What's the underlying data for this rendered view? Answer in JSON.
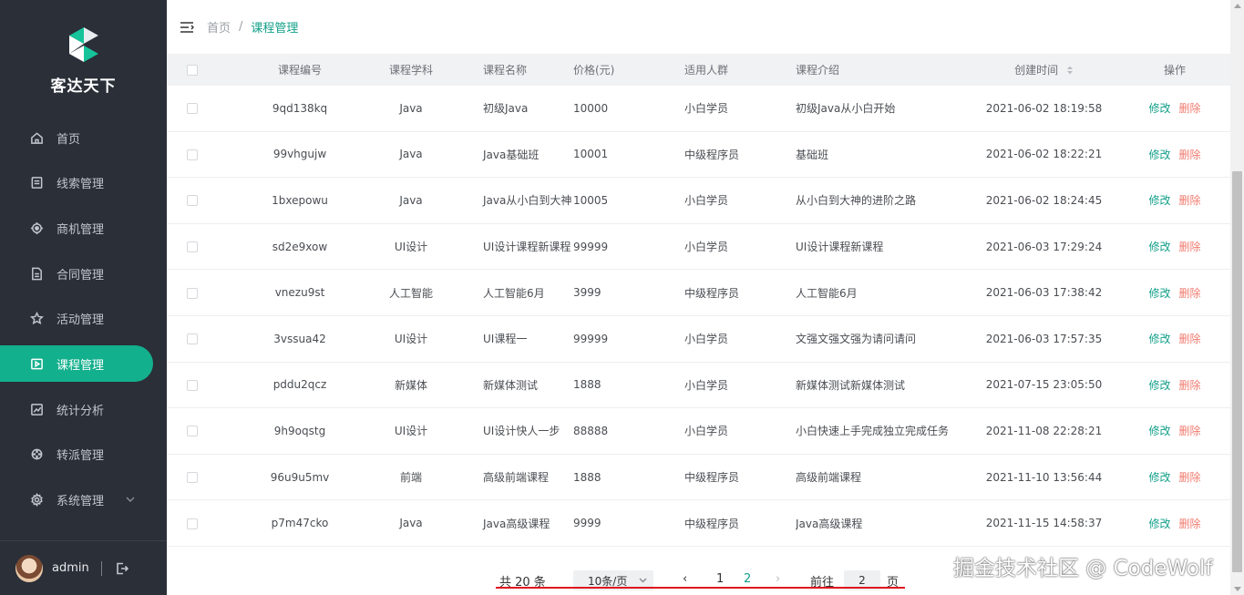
{
  "app": {
    "brand": "客达天下"
  },
  "sidebar": {
    "items": [
      {
        "label": "首页",
        "icon": "home-icon"
      },
      {
        "label": "线索管理",
        "icon": "clipboard-icon"
      },
      {
        "label": "商机管理",
        "icon": "target-icon"
      },
      {
        "label": "合同管理",
        "icon": "document-icon"
      },
      {
        "label": "活动管理",
        "icon": "star-icon"
      },
      {
        "label": "课程管理",
        "icon": "play-icon",
        "active": true
      },
      {
        "label": "统计分析",
        "icon": "chart-icon"
      },
      {
        "label": "转派管理",
        "icon": "transfer-icon"
      },
      {
        "label": "系统管理",
        "icon": "gear-icon",
        "expandable": true
      }
    ],
    "user": {
      "name": "admin"
    }
  },
  "header": {
    "breadcrumb": {
      "home": "首页",
      "separator": "/",
      "current": "课程管理"
    }
  },
  "table": {
    "columns": [
      "课程编号",
      "课程学科",
      "课程名称",
      "价格(元)",
      "适用人群",
      "课程介绍",
      "创建时间",
      "操作"
    ],
    "actions": {
      "edit": "修改",
      "delete": "删除"
    },
    "rows": [
      {
        "id": "9qd138kq",
        "subject": "Java",
        "name": "初级Java",
        "price": "10000",
        "crowd": "小白学员",
        "desc": "初级Java从小白开始",
        "time": "2021-06-02 18:19:58"
      },
      {
        "id": "99vhgujw",
        "subject": "Java",
        "name": "Java基础班",
        "price": "10001",
        "crowd": "中级程序员",
        "desc": "基础班",
        "time": "2021-06-02 18:22:21"
      },
      {
        "id": "1bxepowu",
        "subject": "Java",
        "name": "Java从小白到大神",
        "price": "10005",
        "crowd": "小白学员",
        "desc": "从小白到大神的进阶之路",
        "time": "2021-06-02 18:24:45"
      },
      {
        "id": "sd2e9xow",
        "subject": "UI设计",
        "name": "UI设计课程新课程",
        "price": "99999",
        "crowd": "小白学员",
        "desc": "UI设计课程新课程",
        "time": "2021-06-03 17:29:24"
      },
      {
        "id": "vnezu9st",
        "subject": "人工智能",
        "name": "人工智能6月",
        "price": "3999",
        "crowd": "中级程序员",
        "desc": "人工智能6月",
        "time": "2021-06-03 17:38:42"
      },
      {
        "id": "3vssua42",
        "subject": "UI设计",
        "name": "UI课程一",
        "price": "99999",
        "crowd": "小白学员",
        "desc": "文强文强文强为请问请问",
        "time": "2021-06-03 17:57:35"
      },
      {
        "id": "pddu2qcz",
        "subject": "新媒体",
        "name": "新媒体测试",
        "price": "1888",
        "crowd": "小白学员",
        "desc": "新媒体测试新媒体测试",
        "time": "2021-07-15 23:05:50"
      },
      {
        "id": "9h9oqstg",
        "subject": "UI设计",
        "name": "UI设计快人一步",
        "price": "88888",
        "crowd": "小白学员",
        "desc": "小白快速上手完成独立完成任务",
        "time": "2021-11-08 22:28:21"
      },
      {
        "id": "96u9u5mv",
        "subject": "前端",
        "name": "高级前端课程",
        "price": "1888",
        "crowd": "中级程序员",
        "desc": "高级前端课程",
        "time": "2021-11-10 13:56:44"
      },
      {
        "id": "p7m47cko",
        "subject": "Java",
        "name": "Java高级课程",
        "price": "9999",
        "crowd": "中级程序员",
        "desc": "Java高级课程",
        "time": "2021-11-15 14:58:37"
      }
    ]
  },
  "pagination": {
    "total": "共 20 条",
    "page_size": "10条/页",
    "prev": "‹",
    "pages": [
      "1",
      "2"
    ],
    "current_page": "2",
    "next": "›",
    "goto_prefix": "前往",
    "goto_value": "2",
    "goto_suffix": "页"
  },
  "watermark": "掘金技术社区 @ CodeWolf",
  "colors": {
    "accent": "#13b08d",
    "sidebar_bg": "#2a2f38",
    "delete": "#f07a6e",
    "underline": "#e0151f"
  }
}
